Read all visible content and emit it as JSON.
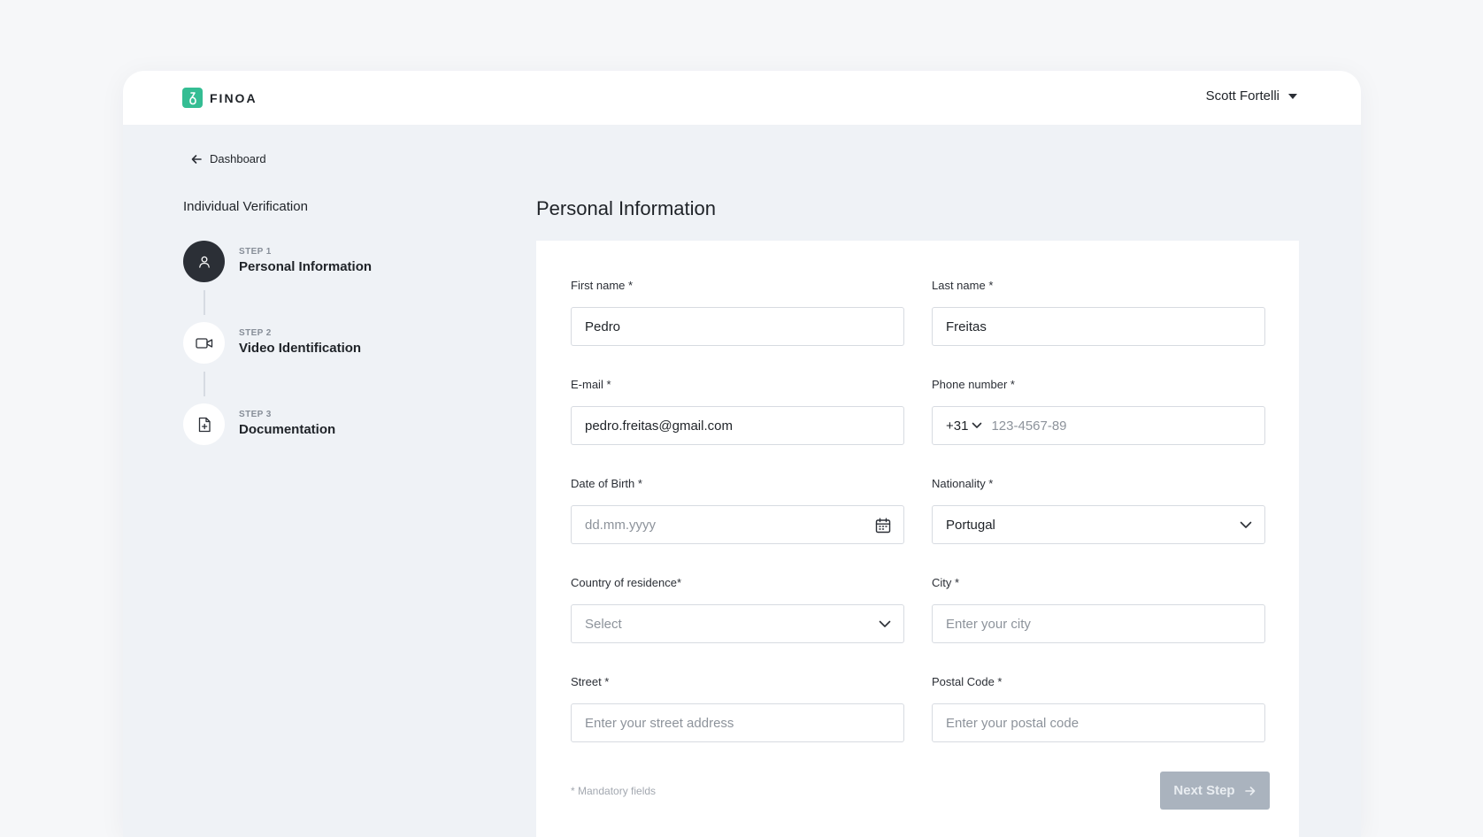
{
  "header": {
    "brand": "FINOA",
    "user_name": "Scott Fortelli"
  },
  "nav": {
    "back_label": "Dashboard"
  },
  "sidebar": {
    "title": "Individual Verification",
    "steps": [
      {
        "num": "STEP 1",
        "label": "Personal Information",
        "icon": "user-icon",
        "active": true
      },
      {
        "num": "STEP 2",
        "label": "Video Identification",
        "icon": "video-icon",
        "active": false
      },
      {
        "num": "STEP 3",
        "label": "Documentation",
        "icon": "document-add-icon",
        "active": false
      }
    ]
  },
  "form": {
    "title": "Personal Information",
    "first_name": {
      "label": "First name *",
      "value": "Pedro"
    },
    "last_name": {
      "label": "Last name *",
      "value": "Freitas"
    },
    "email": {
      "label": "E-mail *",
      "value": "pedro.freitas@gmail.com"
    },
    "phone": {
      "label": "Phone number *",
      "code": "+31",
      "placeholder": "123-4567-89"
    },
    "dob": {
      "label": "Date of Birth *",
      "placeholder": "dd.mm.yyyy"
    },
    "nationality": {
      "label": "Nationality *",
      "value": "Portugal"
    },
    "country": {
      "label": "Country of residence*",
      "placeholder": "Select"
    },
    "city": {
      "label": "City *",
      "placeholder": "Enter your city"
    },
    "street": {
      "label": "Street *",
      "placeholder": "Enter your street address"
    },
    "postal": {
      "label": "Postal Code *",
      "placeholder": "Enter your postal code"
    },
    "mandatory_note": "* Mandatory fields",
    "next_label": "Next Step"
  },
  "colors": {
    "brand": "#34bd93",
    "disabled_button": "#aab3be",
    "active_step": "#2b2f36"
  }
}
